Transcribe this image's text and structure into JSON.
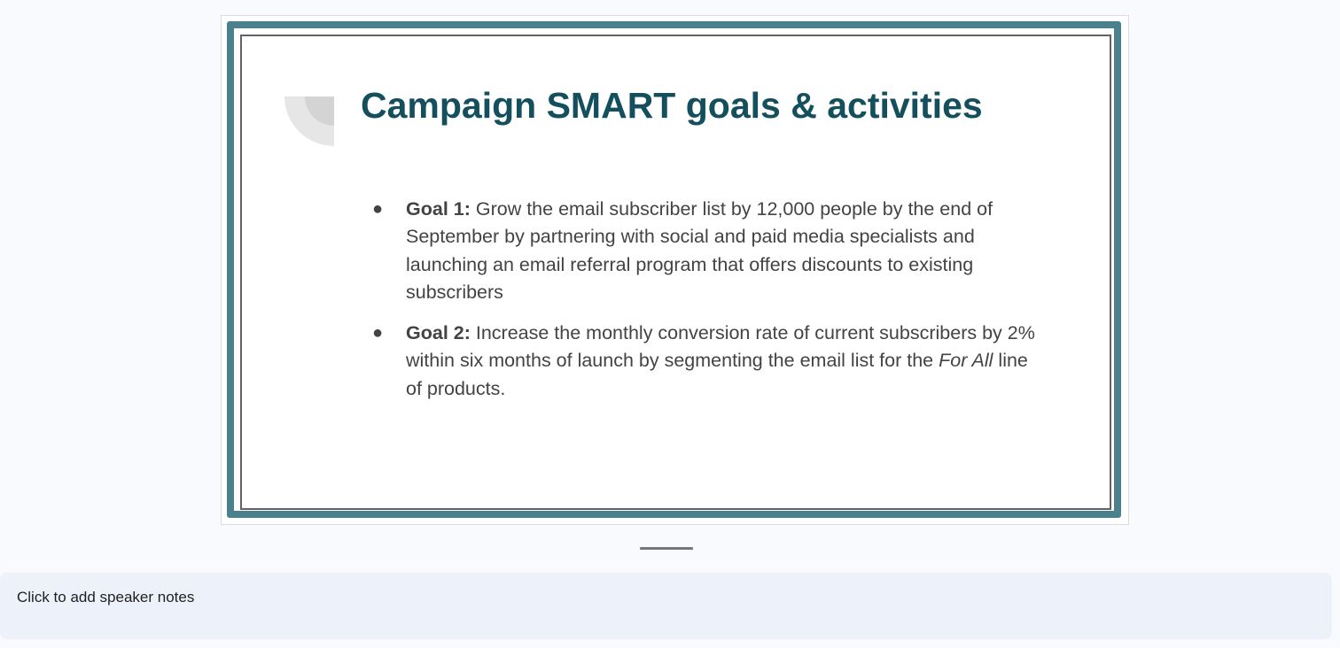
{
  "slide": {
    "title": "Campaign SMART goals & activities",
    "bullet_symbol": "●",
    "bullets": [
      {
        "lead": "Goal 1:",
        "text": " Grow the email subscriber list by 12,000 people by the end of September by partnering with social and paid media specialists and launching an email referral program that offers discounts to existing subscribers"
      },
      {
        "lead": "Goal 2:",
        "text_before": " Increase the monthly conversion rate of current subscribers by 2% within six months of launch by segmenting the email list for the ",
        "emphasis": "For All",
        "text_after": " line of products."
      }
    ]
  },
  "notes": {
    "placeholder": "Click to add speaker notes"
  },
  "colors": {
    "accent_border": "#4a818d",
    "title": "#134f5c",
    "body_text": "#434343",
    "notes_bg": "#edf2fa"
  }
}
